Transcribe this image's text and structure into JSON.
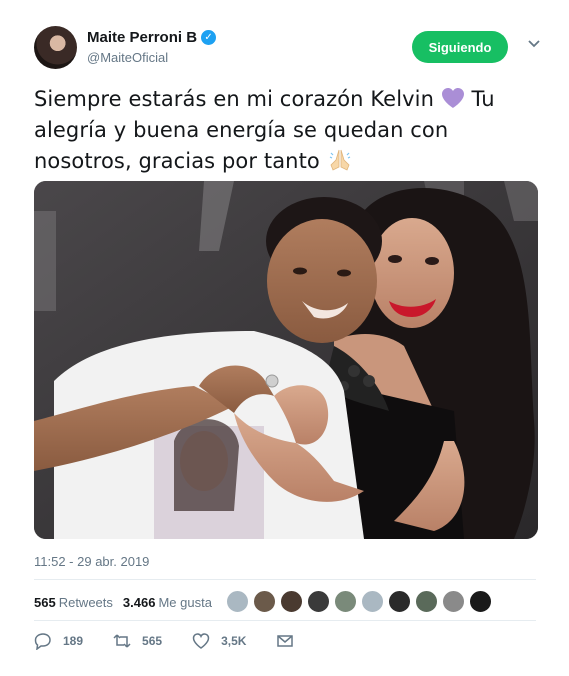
{
  "user": {
    "display_name": "Maite Perroni B",
    "handle": "@MaiteOficial",
    "verified": true,
    "follow_label": "Siguiendo"
  },
  "tweet": {
    "line1_a": "Siempre estarás en mi corazón Kelvin ",
    "line1_b": " Tu",
    "line2": "alegría y buena energía se quedan con",
    "line3": "nosotros, gracias por tanto ",
    "emojis": [
      "purple-heart",
      "folded-hands"
    ]
  },
  "timestamp": "11:52 - 29 abr. 2019",
  "stats": {
    "retweets_count": "565",
    "retweets_label": "Retweets",
    "likes_count": "3.466",
    "likes_label": "Me gusta",
    "liker_avatars": 10
  },
  "actions": {
    "replies": "189",
    "retweets": "565",
    "likes": "3,5K"
  },
  "colors": {
    "follow_green": "#17bf63",
    "verified_blue": "#1da1f2",
    "muted_text": "#657786",
    "heart_purple": "#aa8ed6"
  }
}
